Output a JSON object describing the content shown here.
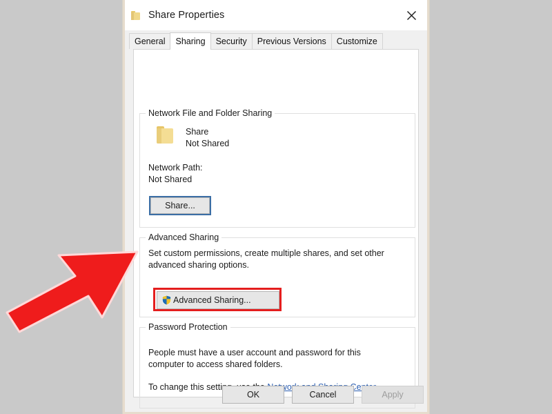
{
  "window": {
    "title": "Share Properties",
    "folder_icon": "folder-icon",
    "close_icon": "close-icon"
  },
  "tabs": [
    {
      "label": "General",
      "active": false
    },
    {
      "label": "Sharing",
      "active": true
    },
    {
      "label": "Security",
      "active": false
    },
    {
      "label": "Previous Versions",
      "active": false
    },
    {
      "label": "Customize",
      "active": false
    }
  ],
  "network_sharing": {
    "legend": "Network File and Folder Sharing",
    "share_name": "Share",
    "share_status": "Not Shared",
    "network_path_label": "Network Path:",
    "network_path_value": "Not Shared",
    "share_button": "Share..."
  },
  "advanced_sharing": {
    "legend": "Advanced Sharing",
    "description_line1": "Set custom permissions, create multiple shares, and set other",
    "description_line2": "advanced sharing options.",
    "button_label": "Advanced Sharing...",
    "button_icon": "uac-shield-icon",
    "highlight_color": "#e41e1e"
  },
  "password_protection": {
    "legend": "Password Protection",
    "description_line1": "People must have a user account and password for this",
    "description_line2": "computer to access shared folders.",
    "setting_prefix": "To change this setting, use the ",
    "link_text": "Network and Sharing Center",
    "setting_suffix": ".",
    "link_color": "#2a5db0"
  },
  "footer": {
    "ok_label": "OK",
    "cancel_label": "Cancel",
    "apply_label": "Apply",
    "apply_disabled": true
  },
  "annotation": {
    "arrow_color": "#ef1c1c",
    "arrow_points_to": "advanced-sharing-button"
  }
}
